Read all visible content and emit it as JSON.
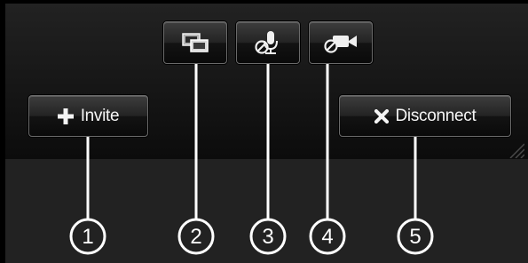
{
  "toolbar": {
    "invite": {
      "label": "Invite",
      "icon": "plus-icon"
    },
    "screen_share": {
      "icon": "screen-share-icon"
    },
    "mute": {
      "icon": "microphone-muted-icon"
    },
    "video": {
      "icon": "camera-off-icon"
    },
    "disconnect": {
      "label": "Disconnect",
      "icon": "close-icon"
    }
  },
  "callouts": {
    "invite": "1",
    "screen_share": "2",
    "mute": "3",
    "video": "4",
    "disconnect": "5"
  },
  "colors": {
    "panel_top": "#222222",
    "panel_bottom": "#0c0c0c",
    "button_border": "#6a6a6a",
    "text": "#f5f5f5",
    "callout_stroke": "#ffffff"
  }
}
